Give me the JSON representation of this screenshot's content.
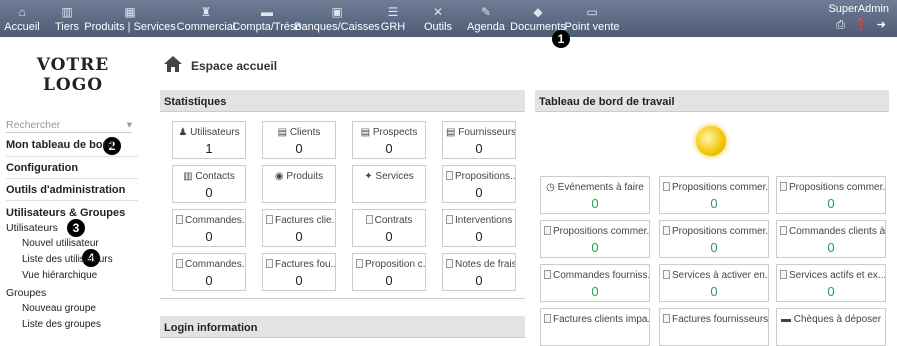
{
  "topbar": {
    "menus": [
      {
        "label": "Accueil",
        "icon": "home-icon",
        "glyph": "⌂"
      },
      {
        "label": "Tiers",
        "icon": "tiers-icon",
        "glyph": "▥"
      },
      {
        "label": "Produits | Services",
        "icon": "products-icon",
        "glyph": "▦"
      },
      {
        "label": "Commercial",
        "icon": "commercial-icon",
        "glyph": "♜"
      },
      {
        "label": "Compta/Tréso",
        "icon": "accounting-icon",
        "glyph": "▬"
      },
      {
        "label": "Banques/Caisses",
        "icon": "bank-icon",
        "glyph": "▣"
      },
      {
        "label": "GRH",
        "icon": "hrm-icon",
        "glyph": "☰"
      },
      {
        "label": "Outils",
        "icon": "tools-icon",
        "glyph": "✕"
      },
      {
        "label": "Agenda",
        "icon": "agenda-icon",
        "glyph": "✎"
      },
      {
        "label": "Documents",
        "icon": "documents-icon",
        "glyph": "◆"
      },
      {
        "label": "Point vente",
        "icon": "pos-icon",
        "glyph": "▭"
      }
    ],
    "user": {
      "name": "SuperAdmin",
      "tools": "⎙ ❓ ➜"
    }
  },
  "markers": [
    "1",
    "2",
    "3",
    "4"
  ],
  "sidebar": {
    "logo_line1": "VOTRE",
    "logo_line2": "LOGO",
    "search_label": "Rechercher",
    "search_arrow": "▾",
    "dashboard": "Mon tableau de bord",
    "configuration": "Configuration",
    "admin_tools": "Outils d'administration",
    "users_groups": "Utilisateurs & Groupes",
    "users": "Utilisateurs",
    "new_user": "Nouvel utilisateur",
    "user_list": "Liste des utilisateurs",
    "hierarchy": "Vue hiérarchique",
    "groups": "Groupes",
    "new_group": "Nouveau groupe",
    "group_list": "Liste des groupes"
  },
  "main": {
    "title": "Espace accueil",
    "stats_title": "Statistiques",
    "login_title": "Login information",
    "board_title": "Tableau de bord de travail",
    "stats": [
      {
        "label": "Utilisateurs",
        "value": "1",
        "icon": "user-icon",
        "glyph": "♟"
      },
      {
        "label": "Clients",
        "value": "0",
        "icon": "clients-icon",
        "glyph": "▤"
      },
      {
        "label": "Prospects",
        "value": "0",
        "icon": "prospects-icon",
        "glyph": "▤"
      },
      {
        "label": "Fournisseurs",
        "value": "0",
        "icon": "suppliers-icon",
        "glyph": "▤"
      },
      {
        "label": "Contacts",
        "value": "0",
        "icon": "contacts-icon",
        "glyph": "▥"
      },
      {
        "label": "Produits",
        "value": "",
        "icon": "product-icon",
        "glyph": "◉"
      },
      {
        "label": "Services",
        "value": "",
        "icon": "service-icon",
        "glyph": "✦"
      },
      {
        "label": "Propositions...",
        "value": "0",
        "icon": "proposal-icon",
        "glyph": ""
      },
      {
        "label": "Commandes...",
        "value": "0",
        "icon": "order-icon",
        "glyph": ""
      },
      {
        "label": "Factures clie...",
        "value": "0",
        "icon": "invoice-icon",
        "glyph": ""
      },
      {
        "label": "Contrats",
        "value": "0",
        "icon": "contract-icon",
        "glyph": ""
      },
      {
        "label": "Interventions",
        "value": "0",
        "icon": "intervention-icon",
        "glyph": ""
      },
      {
        "label": "Commandes...",
        "value": "0",
        "icon": "order-icon",
        "glyph": ""
      },
      {
        "label": "Factures fou...",
        "value": "0",
        "icon": "invoice-icon",
        "glyph": ""
      },
      {
        "label": "Proposition c...",
        "value": "0",
        "icon": "proposal-icon",
        "glyph": ""
      },
      {
        "label": "Notes de frais",
        "value": "0",
        "icon": "expense-icon",
        "glyph": ""
      }
    ],
    "board": [
      {
        "label": "Événements à faire",
        "value": "0",
        "icon": "clock-icon",
        "glyph": "◷"
      },
      {
        "label": "Propositions commer...",
        "value": "0",
        "icon": "doc-icon",
        "glyph": ""
      },
      {
        "label": "Propositions commer...",
        "value": "0",
        "icon": "doc-icon",
        "glyph": ""
      },
      {
        "label": "Propositions commer...",
        "value": "0",
        "icon": "doc-icon",
        "glyph": ""
      },
      {
        "label": "Propositions commer...",
        "value": "0",
        "icon": "doc-icon",
        "glyph": ""
      },
      {
        "label": "Commandes clients à...",
        "value": "0",
        "icon": "doc-icon",
        "glyph": ""
      },
      {
        "label": "Commandes fourniss...",
        "value": "0",
        "icon": "doc-icon",
        "glyph": ""
      },
      {
        "label": "Services à activer en...",
        "value": "0",
        "icon": "doc-icon",
        "glyph": ""
      },
      {
        "label": "Services actifs et ex...",
        "value": "0",
        "icon": "doc-icon",
        "glyph": ""
      },
      {
        "label": "Factures clients impa...",
        "value": "",
        "icon": "doc-icon",
        "glyph": ""
      },
      {
        "label": "Factures fournisseurs...",
        "value": "",
        "icon": "doc-icon",
        "glyph": ""
      },
      {
        "label": "Chèques à déposer",
        "value": "",
        "icon": "cheque-icon",
        "glyph": "▬"
      }
    ]
  },
  "colors": {
    "topbar": "#5a6780",
    "value_green": "#2a9d55"
  }
}
